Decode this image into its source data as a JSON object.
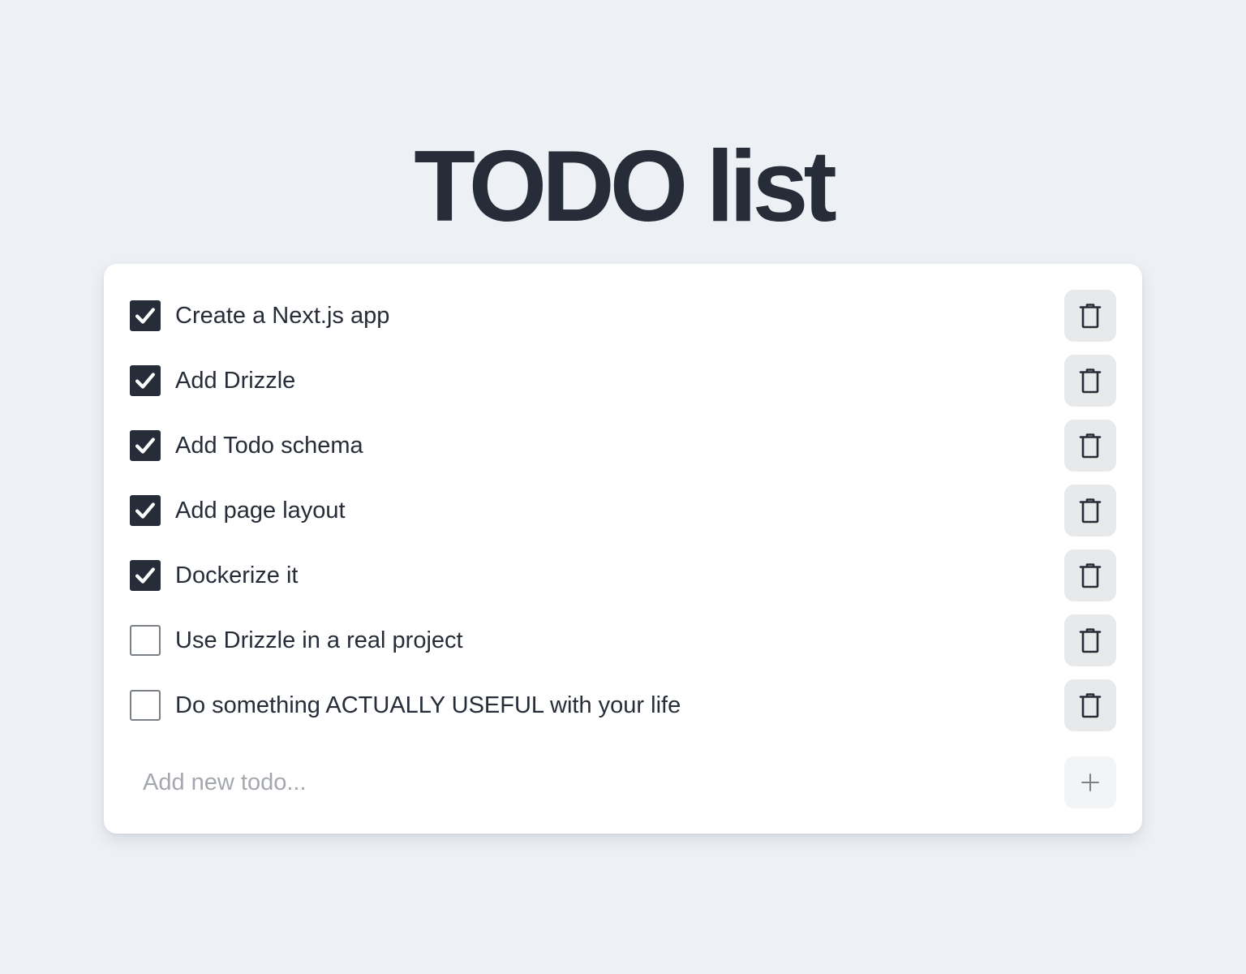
{
  "page": {
    "title": "TODO list"
  },
  "todos": [
    {
      "text": "Create a Next.js app",
      "done": true
    },
    {
      "text": "Add Drizzle",
      "done": true
    },
    {
      "text": "Add Todo schema",
      "done": true
    },
    {
      "text": "Add page layout",
      "done": true
    },
    {
      "text": "Dockerize it",
      "done": true
    },
    {
      "text": "Use Drizzle in a real project",
      "done": false
    },
    {
      "text": "Do something ACTUALLY USEFUL with your life",
      "done": false
    }
  ],
  "add_todo": {
    "placeholder": "Add new todo...",
    "value": ""
  },
  "icons": {
    "check": "check-icon",
    "delete": "trash-icon",
    "add": "plus-icon"
  },
  "colors": {
    "background": "#edf0f5",
    "card": "#ffffff",
    "text": "#262d39",
    "checked_fill": "#262d39",
    "delete_button_bg": "#e8e9eb",
    "add_button_bg": "#f3f4f5",
    "placeholder": "#a4a8ae"
  }
}
